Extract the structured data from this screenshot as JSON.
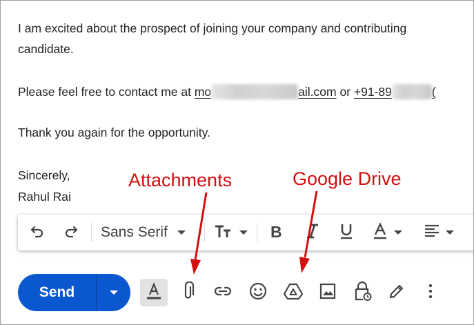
{
  "email": {
    "line1": "I am excited about the prospect of joining your company and contributing",
    "line2": "candidate.",
    "contact_prefix": "Please feel free to contact me at ",
    "email_start": "mo",
    "email_end": "ail.com",
    "contact_or": " or ",
    "phone_start": "+91-89",
    "phone_end": "(",
    "thanks": "Thank you again for the opportunity.",
    "closing": "Sincerely,",
    "signature": "Rahul Rai"
  },
  "annotations": {
    "attachments": "Attachments",
    "google_drive": "Google Drive",
    "color": "#d20f0f"
  },
  "formatting_toolbar": {
    "undo_icon": "undo-icon",
    "redo_icon": "redo-icon",
    "font_family": "Sans Serif",
    "font_size_icon": "text-size-icon",
    "bold_icon": "bold-icon",
    "italic_icon": "italic-icon",
    "underline_icon": "underline-icon",
    "text_color_icon": "text-color-icon",
    "align_icon": "align-left-icon"
  },
  "bottom_toolbar": {
    "send_label": "Send",
    "send_color": "#0b57d0",
    "icons": [
      "formatting-options-icon",
      "attachment-icon",
      "link-icon",
      "emoji-icon",
      "google-drive-icon",
      "photo-icon",
      "confidential-mode-icon",
      "signature-icon",
      "more-options-icon"
    ]
  }
}
